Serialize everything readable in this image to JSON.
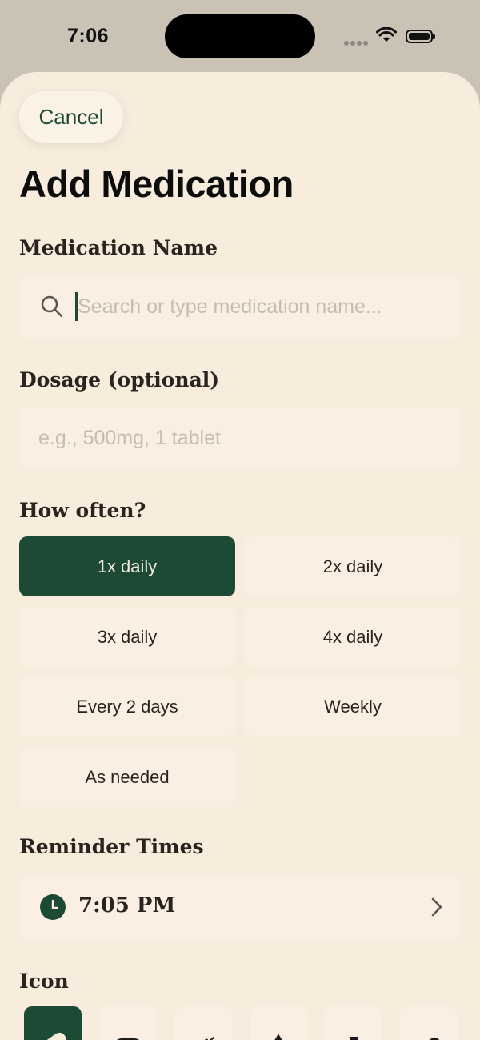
{
  "status_bar": {
    "time": "7:06"
  },
  "header": {
    "cancel_label": "Cancel",
    "title": "Add Medication"
  },
  "medication_name": {
    "label": "Medication Name",
    "placeholder": "Search or type medication name...",
    "icon": "search-icon"
  },
  "dosage": {
    "label": "Dosage (optional)",
    "placeholder": "e.g., 500mg, 1 tablet"
  },
  "frequency": {
    "label": "How often?",
    "selected": "1x daily",
    "options": [
      "1x daily",
      "2x daily",
      "3x daily",
      "4x daily",
      "Every 2 days",
      "Weekly",
      "As needed"
    ]
  },
  "reminders": {
    "label": "Reminder Times",
    "times": [
      "7:05 PM"
    ],
    "icon": "clock-icon"
  },
  "icon_picker": {
    "label": "Icon",
    "selected": "pill-icon",
    "icons": [
      "pill-icon",
      "capsule-icon",
      "syringe-icon",
      "drop-icon",
      "medicine-bottle-icon",
      "bandage-icon"
    ]
  },
  "colors": {
    "accent": "#1d4a34",
    "background": "#f8ecdc",
    "field": "#faefe2",
    "text": "#2a2420"
  }
}
